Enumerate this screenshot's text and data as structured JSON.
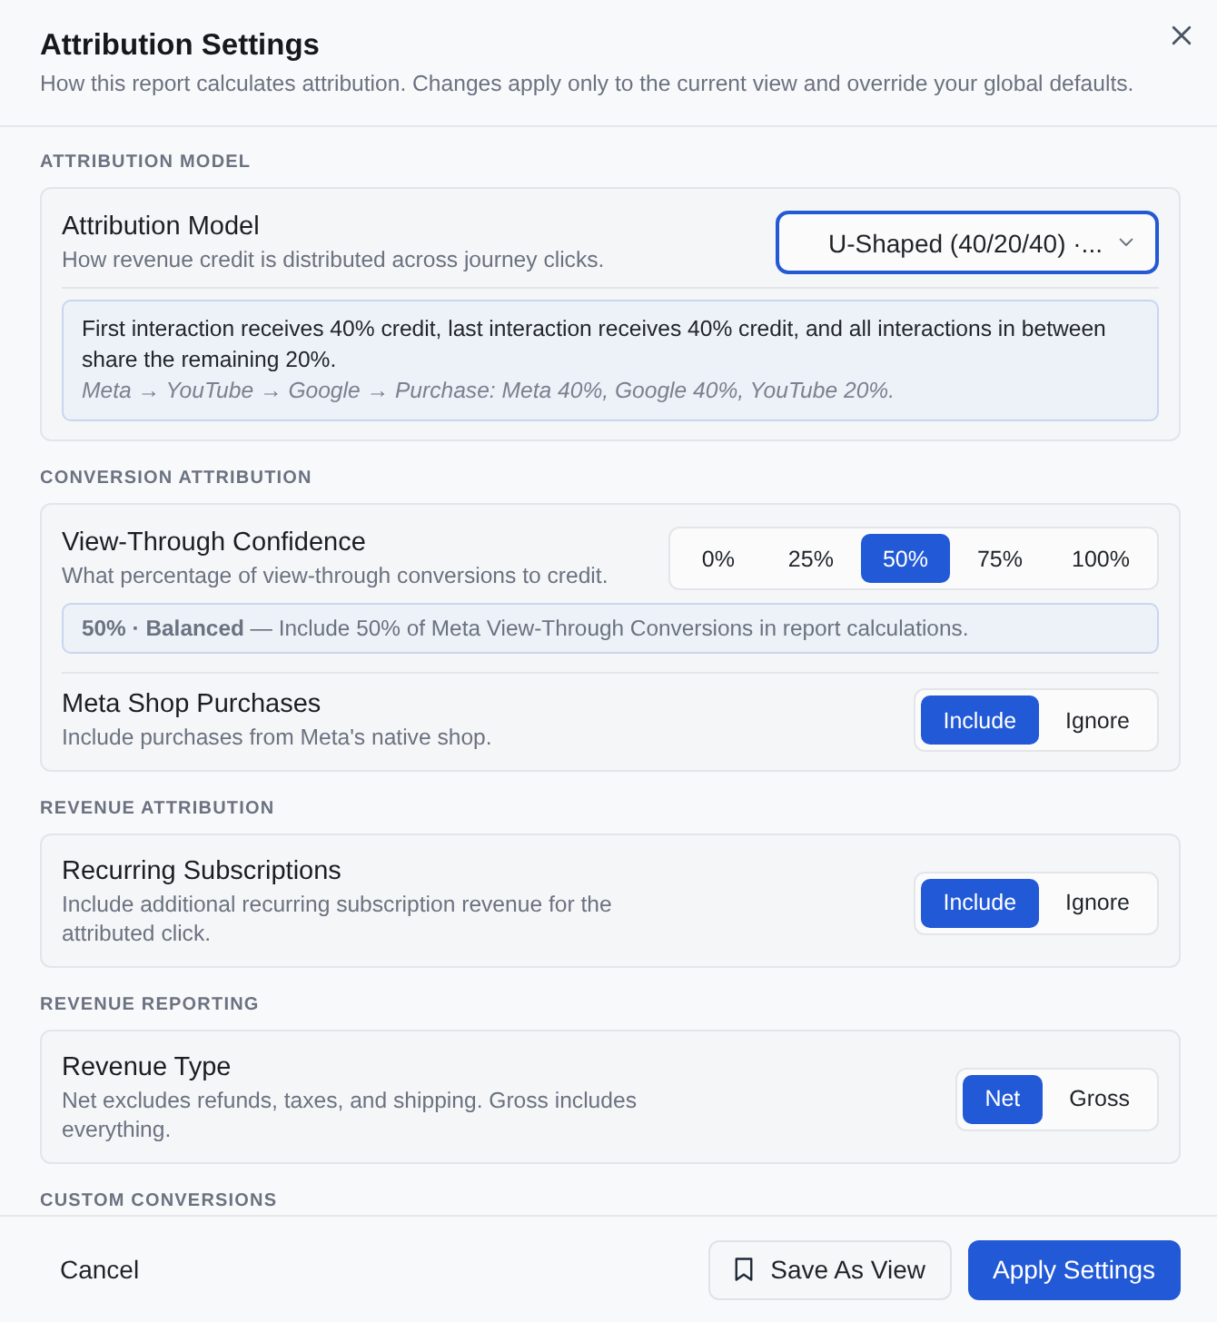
{
  "dialog": {
    "title": "Attribution Settings",
    "subtitle": "How this report calculates attribution. Changes apply only to the current view and override your global defaults."
  },
  "sections": [
    {
      "heading": "ATTRIBUTION MODEL",
      "rows": [
        {
          "kind": "dropdown",
          "label": "Attribution Model",
          "description": "How revenue credit is distributed across journey clicks.",
          "value": "U-Shaped (40/20/40) ·...",
          "focused": true,
          "note": {
            "kind": "explanation",
            "text": "First interaction receives 40% credit, last interaction receives 40% credit, and all interactions in between share the remaining 20%.",
            "example": "Meta → YouTube → Google → Purchase: Meta 40%, Google 40%, YouTube 20%."
          }
        }
      ]
    },
    {
      "heading": "CONVERSION ATTRIBUTION",
      "rows": [
        {
          "kind": "segmented",
          "label": "View-Through Confidence",
          "description": "What percentage of view-through conversions to credit.",
          "options": [
            {
              "label": "0%",
              "selected": false
            },
            {
              "label": "25%",
              "selected": false
            },
            {
              "label": "50%",
              "selected": true
            },
            {
              "label": "75%",
              "selected": false
            },
            {
              "label": "100%",
              "selected": false
            }
          ],
          "note": {
            "kind": "summary",
            "text": "**50% · Balanced** — Include 50% of Meta View-Through Conversions in report calculations."
          }
        },
        {
          "kind": "segmented",
          "label": "Meta Shop Purchases",
          "description": "Include purchases from Meta's native shop.",
          "options": [
            {
              "label": "Include",
              "selected": true
            },
            {
              "label": "Ignore",
              "selected": false
            }
          ]
        }
      ]
    },
    {
      "heading": "REVENUE ATTRIBUTION",
      "rows": [
        {
          "kind": "segmented",
          "label": "Recurring Subscriptions",
          "description": "Include additional recurring subscription revenue for the attributed click.",
          "options": [
            {
              "label": "Include",
              "selected": true
            },
            {
              "label": "Ignore",
              "selected": false
            }
          ]
        }
      ]
    },
    {
      "heading": "REVENUE REPORTING",
      "rows": [
        {
          "kind": "segmented",
          "label": "Revenue Type",
          "description": "Net excludes refunds, taxes, and shipping. Gross includes everything.",
          "options": [
            {
              "label": "Net",
              "selected": true
            },
            {
              "label": "Gross",
              "selected": false
            }
          ]
        }
      ]
    },
    {
      "heading": "CUSTOM CONVERSIONS"
    }
  ],
  "footer": {
    "buttons": [
      {
        "kind": "ghost",
        "label": "Cancel"
      },
      {
        "kind": "secondary",
        "label": "Save As View"
      },
      {
        "kind": "primary",
        "label": "Apply Settings"
      }
    ]
  }
}
